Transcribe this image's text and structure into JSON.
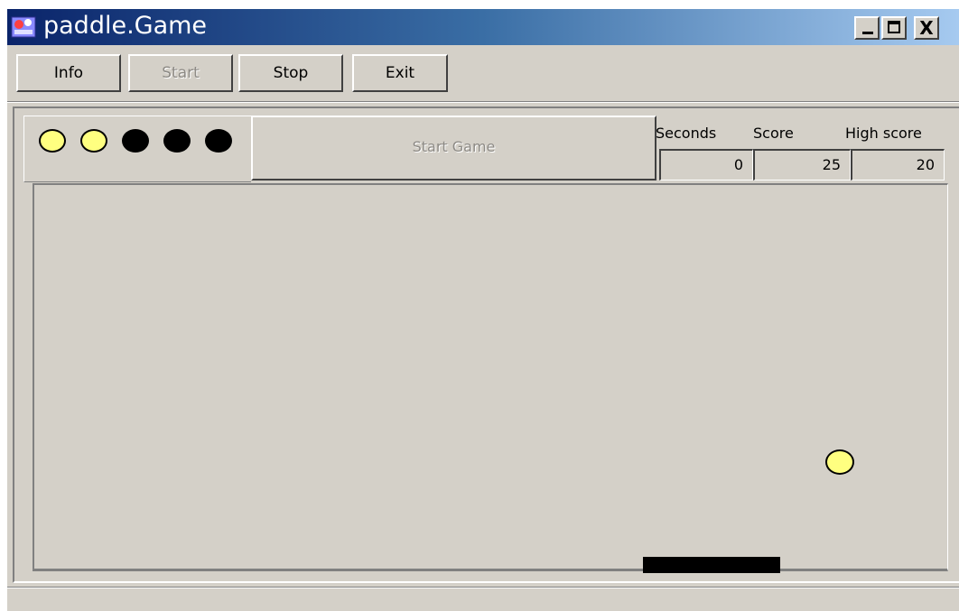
{
  "window": {
    "title": "paddle.Game",
    "controls": {
      "minimize": "_",
      "maximize": "□",
      "close": "X"
    }
  },
  "toolbar": {
    "info_label": "Info",
    "start_label": "Start",
    "stop_label": "Stop",
    "exit_label": "Exit"
  },
  "lives": {
    "total": 5,
    "remaining": 2,
    "filled_color": "#ffff80",
    "spent_color": "#000000"
  },
  "start_game_label": "Start Game",
  "stats": {
    "seconds_label": "Seconds",
    "score_label": "Score",
    "high_score_label": "High score",
    "seconds_value": "0",
    "score_value": "25",
    "high_score_value": "20"
  },
  "game": {
    "ball_color": "#ffff80",
    "paddle_color": "#000000"
  },
  "icons": [
    "app-icon",
    "minimize-icon",
    "maximize-icon",
    "close-icon"
  ]
}
